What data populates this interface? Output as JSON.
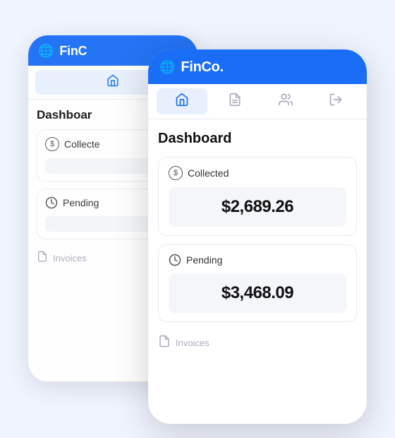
{
  "app": {
    "brand": "FinCo.",
    "globe_icon": "🌐"
  },
  "nav": {
    "tabs": [
      {
        "id": "home",
        "icon": "⌂",
        "active": true,
        "label": "Home"
      },
      {
        "id": "documents",
        "icon": "⧉",
        "active": false,
        "label": "Documents"
      },
      {
        "id": "users",
        "icon": "👥",
        "active": false,
        "label": "Users"
      },
      {
        "id": "logout",
        "icon": "⎋",
        "active": false,
        "label": "Logout"
      }
    ]
  },
  "dashboard": {
    "title": "Dashboard",
    "collected": {
      "label": "Collected",
      "value": "$2,689.26"
    },
    "pending": {
      "label": "Pending",
      "value": "$3,468.09"
    },
    "invoices": {
      "label": "Invoices"
    }
  }
}
